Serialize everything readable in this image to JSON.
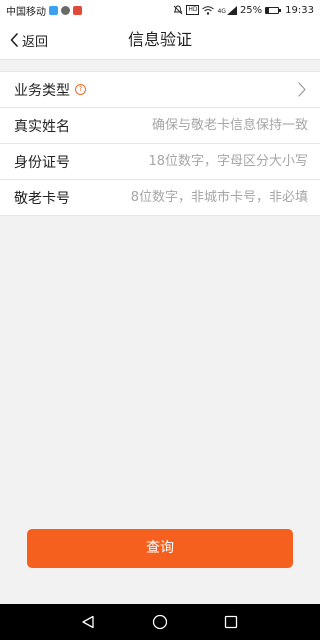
{
  "status_bar": {
    "carrier": "中国移动",
    "battery_text": "25%",
    "battery_level": 0.25,
    "time": "19:33",
    "network": "4G",
    "hd": "HD",
    "app_icon_colors": [
      "#3aa0f0",
      "#6a6a6a",
      "#e04a3a"
    ]
  },
  "nav": {
    "back_label": "返回",
    "title": "信息验证"
  },
  "form": {
    "rows": [
      {
        "label": "业务类型",
        "has_help": true,
        "help_icon_text": "?",
        "type": "select"
      },
      {
        "label": "真实姓名",
        "placeholder": "确保与敬老卡信息保持一致",
        "type": "input"
      },
      {
        "label": "身份证号",
        "placeholder": "18位数字，字母区分大小写",
        "type": "input"
      },
      {
        "label": "敬老卡号",
        "placeholder": "8位数字，非城市卡号，非必填",
        "type": "input"
      }
    ]
  },
  "query_button": {
    "label": "查询",
    "color": "#f5601e"
  },
  "colors": {
    "accent": "#f5601e",
    "page_bg": "#f2f2f2"
  }
}
